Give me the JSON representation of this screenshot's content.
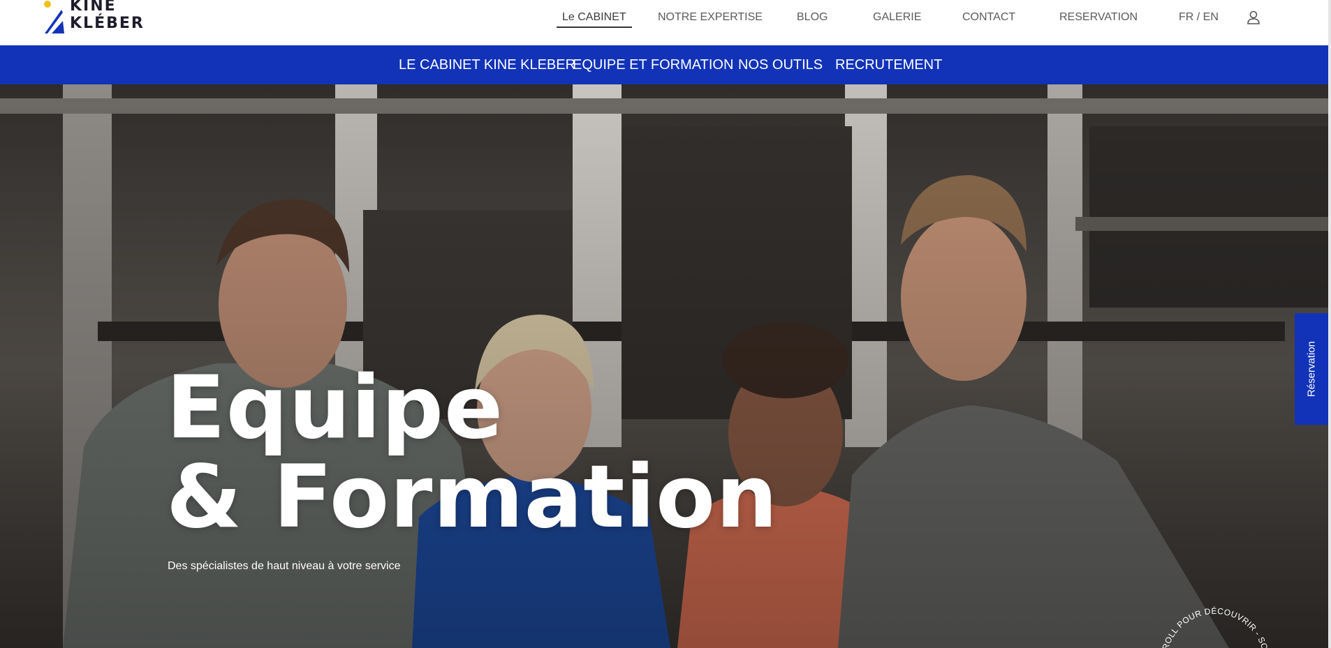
{
  "brand": {
    "line1": "KINÉ",
    "line2": "KLÉBER",
    "colors": {
      "yellow": "#f2c21b",
      "blue": "#1233b8",
      "dark": "#1d1d2b"
    }
  },
  "nav": {
    "items": [
      {
        "label": "Le CABINET",
        "active": true
      },
      {
        "label": "NOTRE EXPERTISE"
      },
      {
        "label": "BLOG"
      },
      {
        "label": "GALERIE"
      },
      {
        "label": "CONTACT"
      },
      {
        "label": "RESERVATION"
      },
      {
        "label": "FR / EN"
      }
    ],
    "user_icon": "user-icon"
  },
  "subnav": {
    "items": [
      {
        "label": "LE CABINET KINE KLEBER"
      },
      {
        "label": "EQUIPE ET FORMATION"
      },
      {
        "label": "NOS OUTILS"
      },
      {
        "label": "RECRUTEMENT"
      }
    ]
  },
  "hero": {
    "title_line1": "Equipe",
    "title_line2": "& Formation",
    "subtitle": "Des spécialistes de haut niveau à votre service"
  },
  "side_tab": {
    "label": "Réservation"
  },
  "scroll_badge": {
    "text": "SCROLL POUR DÉCOUVRIR - SCROLL POUR DÉCOUVRIR - "
  }
}
